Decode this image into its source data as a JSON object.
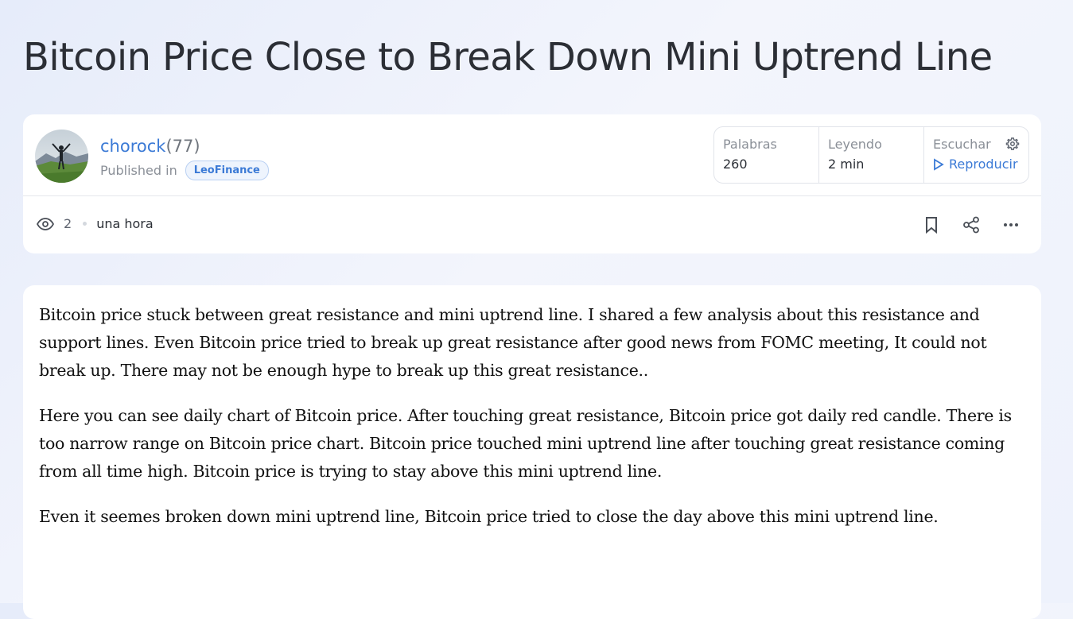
{
  "post": {
    "title": "Bitcoin Price Close to Break Down Mini Uptrend Line",
    "author": {
      "name": "chorock",
      "reputation": "(77)"
    },
    "published_label": "Published in",
    "community": "LeoFinance",
    "stats": {
      "words_label": "Palabras",
      "words_value": "260",
      "reading_label": "Leyendo",
      "reading_value": "2 min",
      "listen_label": "Escuchar",
      "play_label": "Reproducir"
    },
    "views": "2",
    "time_ago": "una hora",
    "paragraphs": [
      "Bitcoin price stuck between great resistance and mini uptrend line. I shared a few analysis about this resistance and support lines. Even Bitcoin price tried to break up great resistance after good news from FOMC meeting, It could not break up. There may not be enough hype to break up this great resistance..",
      "Here you can see daily chart of Bitcoin price. After touching great resistance, Bitcoin price got daily red candle. There is too narrow range on Bitcoin price chart. Bitcoin price touched mini uptrend line after touching great resistance coming from all time high. Bitcoin price is trying to stay above this mini uptrend line.",
      "Even it seemes broken down mini uptrend line, Bitcoin price tried to close the day above this mini uptrend line."
    ]
  },
  "icons": {
    "views": "eye-icon",
    "settings": "gear-icon",
    "play": "play-icon",
    "bookmark": "bookmark-icon",
    "share": "share-icon",
    "more": "more-icon"
  },
  "colors": {
    "accent": "#3b7ad6",
    "text": "#2b2f36",
    "muted": "#8a8f97"
  }
}
